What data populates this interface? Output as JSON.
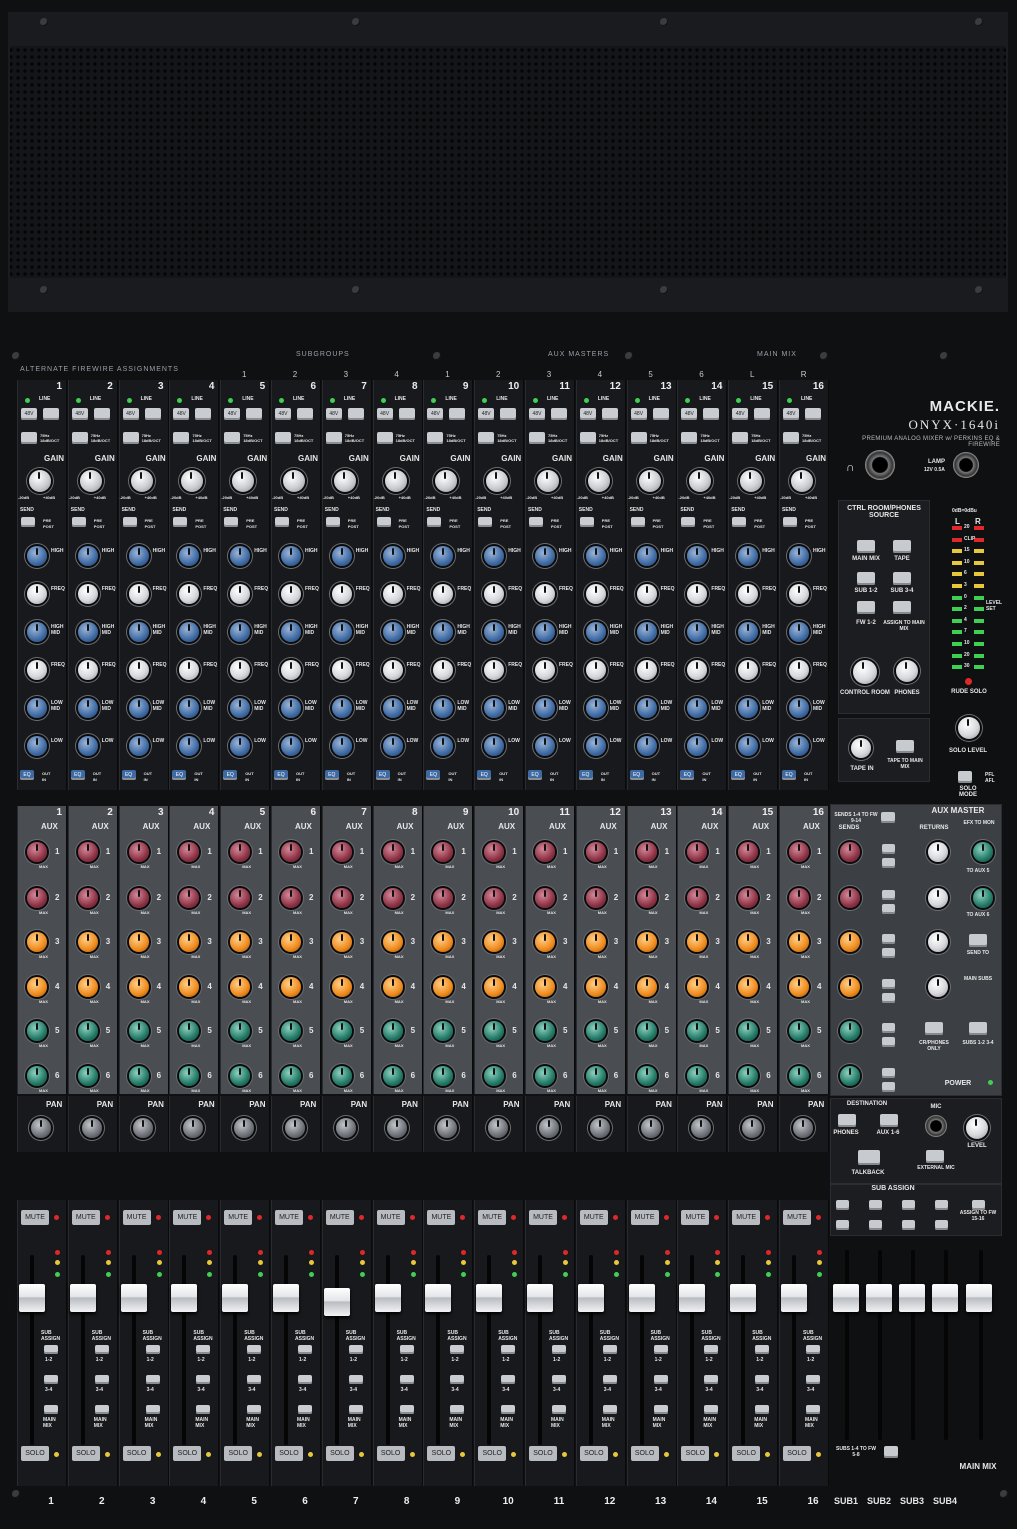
{
  "brand": {
    "maker": "MACKIE.",
    "model": "ONYX·1640i",
    "tagline": "PREMIUM ANALOG MIXER w/ PERKINS EQ & FIREWIRE"
  },
  "header": {
    "alt_firewire": "ALTERNATE FIREWIRE ASSIGNMENTS",
    "subgroups": "SUBGROUPS",
    "aux_masters": "AUX MASTERS",
    "main_mix": "MAIN MIX",
    "alt_numbers": [
      "1",
      "2",
      "3",
      "4",
      "1",
      "2",
      "3",
      "4",
      "5",
      "6",
      "L",
      "R"
    ]
  },
  "channels": [
    "1",
    "2",
    "3",
    "4",
    "5",
    "6",
    "7",
    "8",
    "9",
    "10",
    "11",
    "12",
    "13",
    "14",
    "15",
    "16"
  ],
  "channel_labels": {
    "gain": "GAIN",
    "send": "SEND",
    "pre": "PRE",
    "post": "POST",
    "high": "HIGH",
    "freq": "FREQ",
    "high_mid": "HIGH MID",
    "low_mid": "LOW MID",
    "low": "LOW",
    "eq": "EQ",
    "aux": "AUX",
    "pan": "PAN",
    "mute": "MUTE",
    "solo": "SOLO",
    "sub_assign": "SUB ASSIGN",
    "sub_12": "1-2",
    "sub_34": "3-4",
    "main_mix": "MAIN MIX",
    "line": "LINE",
    "phantom": "48V",
    "hpf": "75Hz 18dB/OCT",
    "out": "OUT",
    "in": "IN",
    "max": "MAX",
    "gain_min": "-20dB",
    "gain_max": "+40dB"
  },
  "aux_numbers": [
    "1",
    "2",
    "3",
    "4",
    "5",
    "6"
  ],
  "master": {
    "ctrl_room_title": "CTRL ROOM/PHONES SOURCE",
    "main_mix_btn": "MAIN MIX",
    "tape_btn": "TAPE",
    "sub12_btn": "SUB 1-2",
    "sub34_btn": "SUB 3-4",
    "fw12_btn": "FW 1-2",
    "assign_main": "ASSIGN TO MAIN MIX",
    "control_room": "CONTROL ROOM",
    "phones": "PHONES",
    "tape_in": "TAPE IN",
    "tape_to_main": "TAPE TO MAIN MIX",
    "rude_solo": "RUDE SOLO",
    "solo_level": "SOLO LEVEL",
    "solo_mode": "SOLO MODE",
    "pfl_afl": "PFL AFL",
    "lamp": "LAMP",
    "lamp_rating": "12V 0.5A",
    "meter_top": "0dB=0dBu",
    "meter_l": "L",
    "meter_r": "R",
    "meter_marks": [
      "20",
      "CLIP",
      "15",
      "10",
      "6",
      "3",
      "0",
      "2",
      "4",
      "7",
      "10",
      "20",
      "30"
    ],
    "level_set": "LEVEL SET",
    "aux_master": "AUX MASTER",
    "sends_1_4": "SENDS 1-4 TO FW 9-14",
    "sends": "SENDS",
    "returns": "RETURNS",
    "efx_to_mon": "EFX TO MON",
    "to_aux5": "TO AUX 5",
    "to_aux6": "TO AUX 6",
    "send_to": "SEND TO",
    "main_subs": "MAIN SUBS",
    "crphones_only": "CR/PHONES ONLY",
    "subs_12_34": "SUBS 1-2 3-4",
    "power": "POWER",
    "destination": "DESTINATION",
    "phones_dest": "PHONES",
    "aux_16": "AUX 1-6",
    "mic": "MIC",
    "level": "LEVEL",
    "talkback": "TALKBACK",
    "external_mic": "EXTERNAL MIC",
    "sub_assign": "SUB ASSIGN",
    "assign_fw": "ASSIGN TO FW 15-16",
    "subs_to_fw": "SUBS 1-4 TO FW 5-8",
    "subs": [
      "SUB1",
      "SUB2",
      "SUB3",
      "SUB4"
    ],
    "main_mix_label": "MAIN MIX"
  },
  "colors": {
    "panel": "#18191c",
    "aux_section": "#4a4d52",
    "knob_blue": "#3e6aa3",
    "knob_red": "#8e3245",
    "knob_orange": "#ef8a1c",
    "knob_teal": "#227a66",
    "led_green": "#3fcf52",
    "led_red": "#e0282a"
  },
  "fader_levels": [
    0.82,
    0.82,
    0.82,
    0.82,
    0.82,
    0.82,
    0.8,
    0.82,
    0.82,
    0.82,
    0.82,
    0.82,
    0.82,
    0.82,
    0.82,
    0.82
  ],
  "sub_fader_levels": [
    0.82,
    0.82,
    0.82,
    0.82
  ],
  "main_fader_level": 0.82
}
